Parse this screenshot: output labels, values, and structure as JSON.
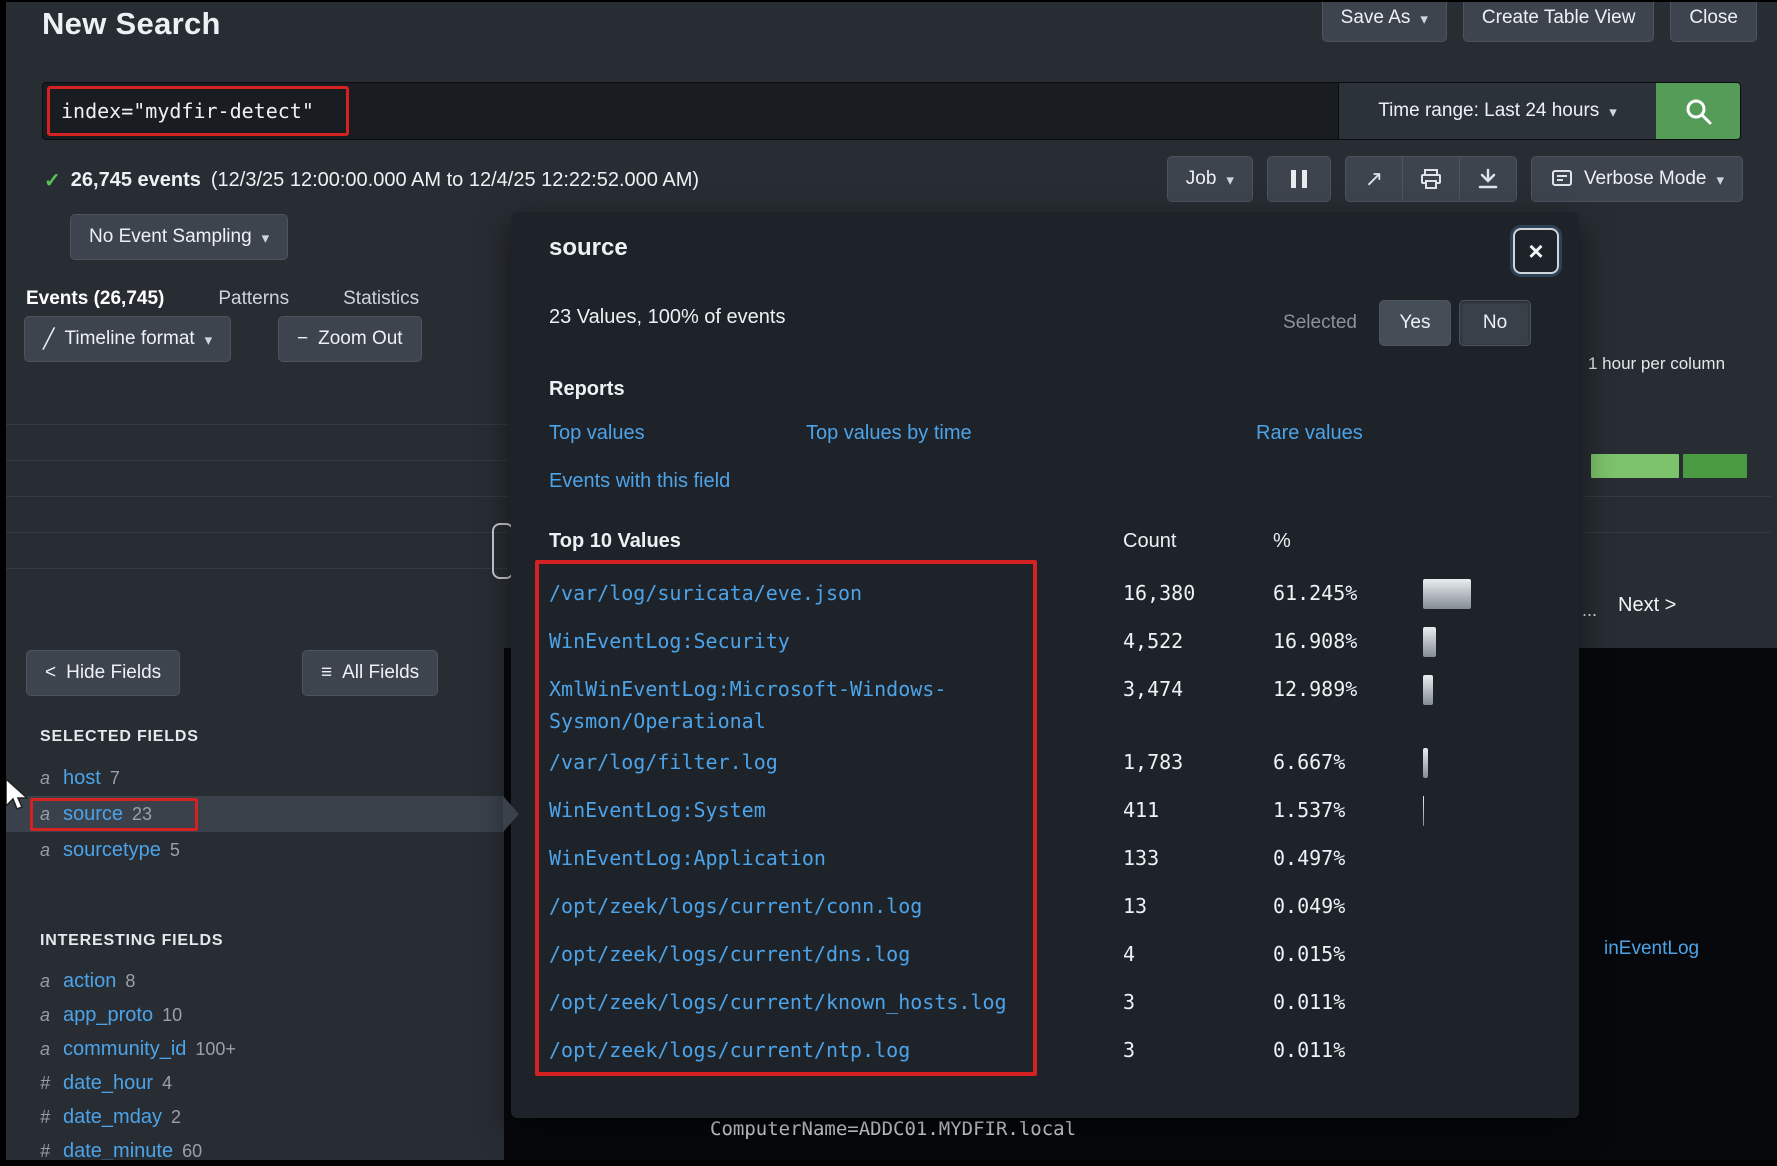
{
  "header": {
    "title": "New Search",
    "save_as": "Save As",
    "create_table_view": "Create Table View",
    "close": "Close"
  },
  "search": {
    "query": "index=\"mydfir-detect\"",
    "time_range": "Time range: Last 24 hours"
  },
  "results": {
    "events_bold": "26,745 events",
    "events_range": "(12/3/25 12:00:00.000 AM to 12/4/25 12:22:52.000 AM)",
    "job_label": "Job",
    "verbose_label": "Verbose Mode",
    "sampling_label": "No Event Sampling"
  },
  "tabs": [
    {
      "label": "Events (26,745)",
      "active": true
    },
    {
      "label": "Patterns",
      "active": false
    },
    {
      "label": "Statistics",
      "active": false
    }
  ],
  "timeline": {
    "format_label": "Timeline format",
    "zoom_out_label": "Zoom Out",
    "scale_note": "1 hour per column",
    "ellipsis": "...",
    "next_label": "Next >"
  },
  "sidebar": {
    "hide_fields_label": "Hide Fields",
    "all_fields_label": "All Fields",
    "selected_heading": "SELECTED FIELDS",
    "interesting_heading": "INTERESTING FIELDS",
    "selected": [
      {
        "type": "a",
        "name": "host",
        "count": "7"
      },
      {
        "type": "a",
        "name": "source",
        "count": "23",
        "highlighted": true,
        "annotated": true
      },
      {
        "type": "a",
        "name": "sourcetype",
        "count": "5"
      }
    ],
    "interesting": [
      {
        "type": "a",
        "name": "action",
        "count": "8"
      },
      {
        "type": "a",
        "name": "app_proto",
        "count": "10"
      },
      {
        "type": "a",
        "name": "community_id",
        "count": "100+"
      },
      {
        "type": "#",
        "name": "date_hour",
        "count": "4"
      },
      {
        "type": "#",
        "name": "date_mday",
        "count": "2"
      },
      {
        "type": "#",
        "name": "date_minute",
        "count": "60"
      }
    ]
  },
  "popup": {
    "title": "source",
    "summary": "23 Values, 100% of events",
    "selected_label": "Selected",
    "yes_label": "Yes",
    "no_label": "No",
    "reports_heading": "Reports",
    "links": {
      "top_values": "Top values",
      "top_values_by_time": "Top values by time",
      "rare_values": "Rare values",
      "events_with_field": "Events with this field"
    },
    "table": {
      "heading": "Top 10 Values",
      "count_header": "Count",
      "pct_header": "%",
      "rows": [
        {
          "value": "/var/log/suricata/eve.json",
          "count": "16,380",
          "pct": "61.245%"
        },
        {
          "value": "WinEventLog:Security",
          "count": "4,522",
          "pct": "16.908%"
        },
        {
          "value": "XmlWinEventLog:Microsoft-Windows-Sysmon/Operational",
          "count": "3,474",
          "pct": "12.989%"
        },
        {
          "value": "/var/log/filter.log",
          "count": "1,783",
          "pct": "6.667%"
        },
        {
          "value": "WinEventLog:System",
          "count": "411",
          "pct": "1.537%"
        },
        {
          "value": "WinEventLog:Application",
          "count": "133",
          "pct": "0.497%"
        },
        {
          "value": "/opt/zeek/logs/current/conn.log",
          "count": "13",
          "pct": "0.049%"
        },
        {
          "value": "/opt/zeek/logs/current/dns.log",
          "count": "4",
          "pct": "0.015%"
        },
        {
          "value": "/opt/zeek/logs/current/known_hosts.log",
          "count": "3",
          "pct": "0.011%"
        },
        {
          "value": "/opt/zeek/logs/current/ntp.log",
          "count": "3",
          "pct": "0.011%"
        }
      ]
    }
  },
  "events_panel": {
    "computer_name": "ComputerName=ADDC01.MYDFIR.local",
    "partial_legend": "inEventLog"
  },
  "icons": {
    "caret_down": "▾",
    "check": "✓",
    "close": "×",
    "chevron_left": "<",
    "list": "≡",
    "slash": "╱",
    "minus": "−",
    "share": "↗"
  },
  "colors": {
    "accent_blue": "#4da3e8",
    "search_green": "#549c57",
    "annotation_red": "#d42222",
    "timeline_green": "#7cc36c"
  }
}
